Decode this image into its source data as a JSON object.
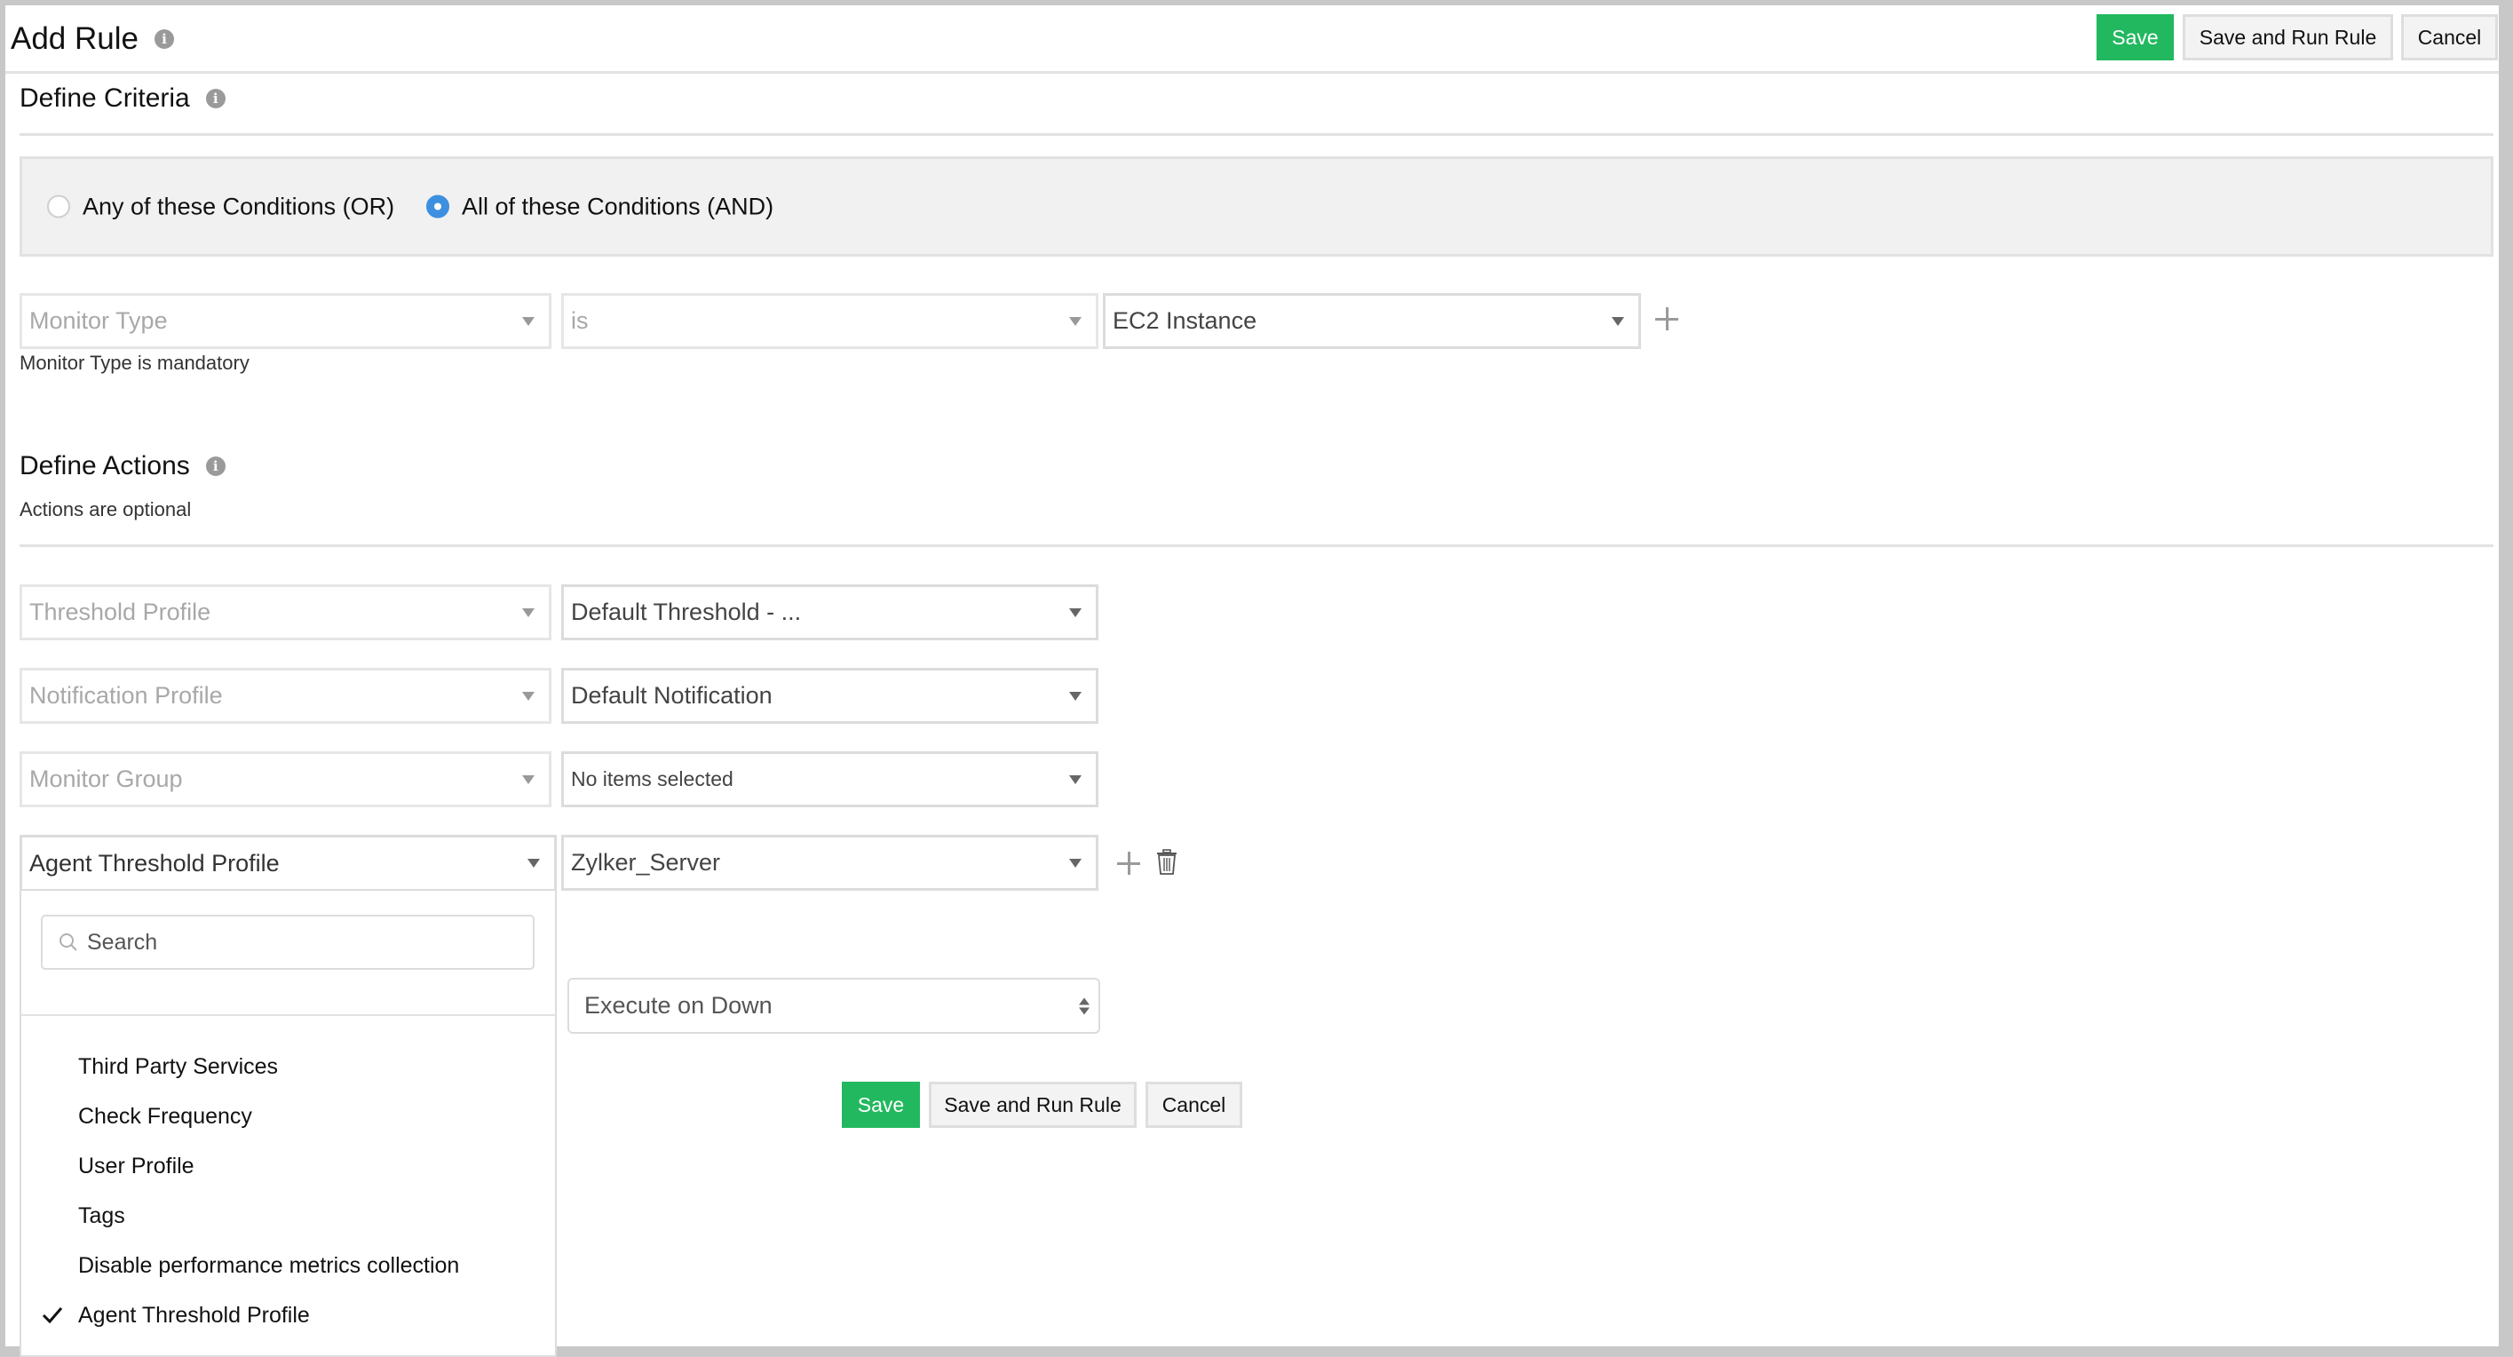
{
  "header": {
    "title": "Add Rule",
    "buttons": {
      "save": "Save",
      "save_run": "Save and Run Rule",
      "cancel": "Cancel"
    }
  },
  "criteria": {
    "title": "Define Criteria",
    "match_options": [
      {
        "label": "Any of these Conditions (OR)",
        "selected": false
      },
      {
        "label": "All of these Conditions (AND)",
        "selected": true
      }
    ],
    "condition": {
      "field": "Monitor Type",
      "operator": "is",
      "value": "EC2 Instance"
    },
    "validation_message": "Monitor Type is mandatory"
  },
  "actions": {
    "title": "Define Actions",
    "subtitle": "Actions are optional",
    "rows": [
      {
        "field": "Threshold Profile",
        "value": "Default Threshold - ..."
      },
      {
        "field": "Notification Profile",
        "value": "Default Notification"
      },
      {
        "field": "Monitor Group",
        "value": "No items selected"
      },
      {
        "field": "Agent Threshold Profile",
        "value": "Zylker_Server"
      }
    ],
    "dropdown": {
      "search_placeholder": "Search",
      "items": [
        {
          "label": "Third Party Services",
          "checked": false
        },
        {
          "label": "Check Frequency",
          "checked": false
        },
        {
          "label": "User Profile",
          "checked": false
        },
        {
          "label": "Tags",
          "checked": false
        },
        {
          "label": "Disable performance metrics collection",
          "checked": false
        },
        {
          "label": "Agent Threshold Profile",
          "checked": true
        }
      ]
    },
    "execute_option": "Execute on Down"
  },
  "footer": {
    "buttons": {
      "save": "Save",
      "save_run": "Save and Run Rule",
      "cancel": "Cancel"
    }
  },
  "colors": {
    "primary": "#22b85f",
    "radio_selected": "#3d8fe0"
  }
}
